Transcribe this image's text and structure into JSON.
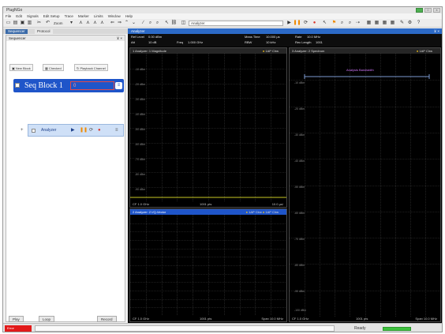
{
  "app": {
    "title": "PlugNGo"
  },
  "window_buttons": [
    "min-icon",
    "max-icon",
    "close-icon"
  ],
  "menu": [
    "File",
    "Edit",
    "Signals",
    "Edit Setup",
    "Trace",
    "Marker",
    "Limits",
    "Window",
    "Help"
  ],
  "toolbar": {
    "items": [
      "new-icon",
      "open-icon",
      "save-icon",
      "print-icon",
      "cut-icon",
      "undo-icon"
    ],
    "zoom_label": "Zoom",
    "analyzer_combo": "Analyzer",
    "run_icons": [
      "play-icon",
      "pause-icon",
      "record-icon",
      "stop-icon",
      "arrow-icon",
      "layout-icon",
      "help-icon"
    ]
  },
  "left_tabs": {
    "active": "Sequencer",
    "inactive": "Protocol"
  },
  "sequencer": {
    "header": "Sequencer",
    "buttons": [
      "New Block",
      "Checked",
      "Playback Channel"
    ],
    "block_label": "Seq Block 1",
    "block_value": "0",
    "analyzer_label": "Analyzer",
    "bottom_buttons": [
      "Play",
      "Loop",
      "Record"
    ]
  },
  "main": {
    "title": "Analyzer",
    "params": {
      "ref_level_label": "Ref Level",
      "ref_level": "0.00 dBm",
      "att_label": "Att",
      "att": "10 dB",
      "freq_label": "Freq",
      "freq": "1.000 GHz",
      "meas_time_label": "Meas Time",
      "meas_time": "10.000 µs",
      "rbw_label": "RBW",
      "rbw": "10 kHz",
      "rate_label": "Rate",
      "rate": "10.0 MHz",
      "rec_length_label": "Rec Length",
      "rec_length": "1001"
    },
    "panes": {
      "mag": {
        "title": "1 Analyzer: 1 Magnitude",
        "indicator": "1AP Clrw",
        "foot_left": "CF 1.0 GHz",
        "foot_mid": "1001 pts",
        "foot_right": "10.0 µs/"
      },
      "iq": {
        "title": "2 Analyzer: 2 I/Q-Vector",
        "indicator": "1AP Clrw",
        "indicator2": "1AP Clrw",
        "foot_left": "CF 1.0 GHz",
        "foot_mid": "1001 pts",
        "foot_right": "Span 10.0 MHz"
      },
      "spec": {
        "title": "3 Analyzer: 2 Spectrum",
        "indicator": "1AP Clrw",
        "annotation": "Analysis Bandwidth",
        "foot_left": "CF 1.0 GHz",
        "foot_mid": "1001 pts",
        "foot_right": "Span 10.0 MHz"
      }
    },
    "y_ticks_mag": [
      "-10 dBm",
      "-20 dBm",
      "-30 dBm",
      "-40 dBm",
      "-50 dBm",
      "-60 dBm",
      "-70 dBm",
      "-80 dBm",
      "-90 dBm"
    ],
    "y_ticks_spec": [
      "-10 dBm",
      "-20 dBm",
      "-30 dBm",
      "-40 dBm",
      "-50 dBm",
      "-60 dBm",
      "-70 dBm",
      "-80 dBm",
      "-90 dBm",
      "-100 dBm"
    ]
  },
  "status": {
    "error": "Error",
    "ready": "Ready"
  },
  "colors": {
    "accent": "#2c6ac7",
    "seq_block": "#1f55c9",
    "grid": "#3a3a3a",
    "status_error": "#e21a1a",
    "status_ok": "#3ec23e",
    "annotation": "#d277ff"
  }
}
